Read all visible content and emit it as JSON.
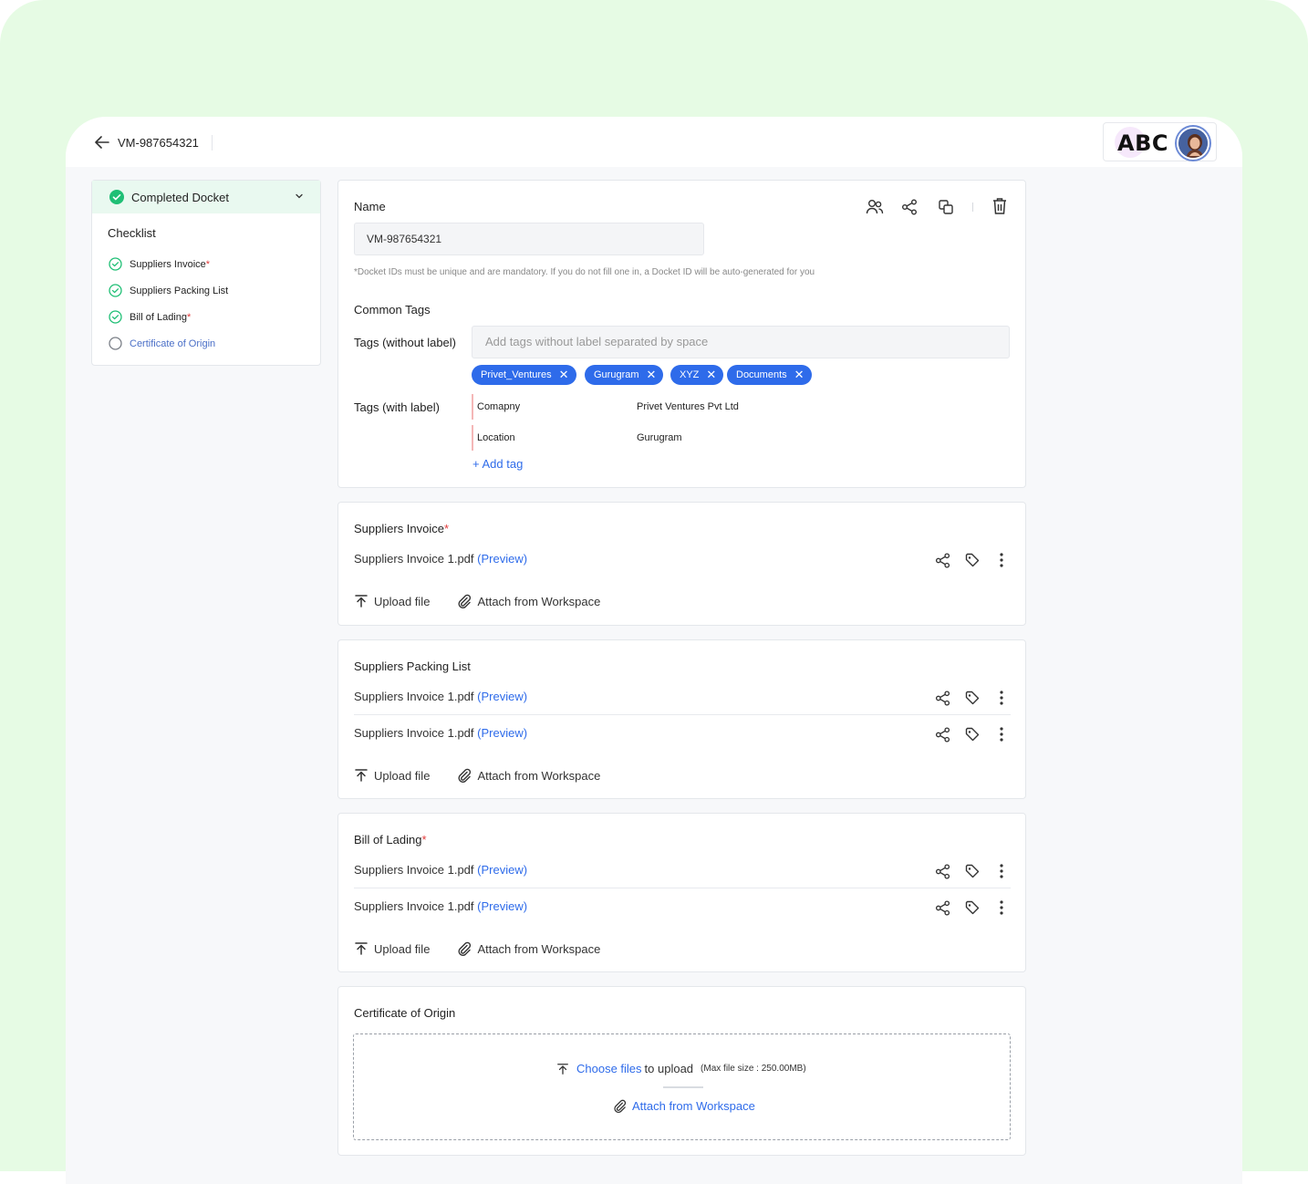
{
  "header": {
    "docket_id": "VM-987654321",
    "brand": "ABC"
  },
  "sidebar": {
    "status_label": "Completed Docket",
    "checklist_title": "Checklist",
    "items": [
      {
        "label": "Suppliers Invoice",
        "required": "*",
        "done": true
      },
      {
        "label": "Suppliers Packing List",
        "required": "",
        "done": true
      },
      {
        "label": "Bill of Lading",
        "required": "*",
        "done": true
      },
      {
        "label": "Certificate of Origin",
        "required": "",
        "done": false
      }
    ]
  },
  "details": {
    "name_label": "Name",
    "name_value": "VM-987654321",
    "hint": "*Docket IDs must be unique and are mandatory. If you do not fill one in, a Docket ID will be auto-generated for you",
    "common_tags_label": "Common Tags",
    "tags_without_label": "Tags (without label)",
    "tags_placeholder": "Add tags without label separated by space",
    "chips": [
      "Privet_Ventures",
      "Gurugram",
      "XYZ",
      "Documents"
    ],
    "tags_with_label": "Tags (with label)",
    "label_tags": [
      {
        "key": "Comapny",
        "value": "Privet Ventures Pvt Ltd"
      },
      {
        "key": "Location",
        "value": "Gurugram"
      }
    ],
    "add_tag": "+ Add tag"
  },
  "sections": {
    "suppliers_invoice": {
      "title": "Suppliers Invoice",
      "required": "*",
      "files": [
        {
          "name": "Suppliers Invoice 1.pdf",
          "preview": "(Preview)"
        }
      ]
    },
    "packing_list": {
      "title": "Suppliers Packing List",
      "files": [
        {
          "name": "Suppliers Invoice 1.pdf",
          "preview": "(Preview)"
        },
        {
          "name": "Suppliers Invoice 1.pdf",
          "preview": "(Preview)"
        }
      ]
    },
    "bill_of_lading": {
      "title": "Bill of Lading",
      "required": "*",
      "files": [
        {
          "name": "Suppliers Invoice 1.pdf",
          "preview": "(Preview)"
        },
        {
          "name": "Suppliers Invoice 1.pdf",
          "preview": "(Preview)"
        }
      ]
    },
    "certificate": {
      "title": "Certificate of Origin",
      "choose_files": "Choose files",
      "to_upload": "to upload",
      "max_size": "(Max file size : 250.00MB)",
      "attach": "Attach from Workspace"
    }
  },
  "actions": {
    "upload": "Upload file",
    "attach": "Attach from Workspace"
  },
  "colors": {
    "accent": "#2e6bea",
    "success": "#1fbf75",
    "page_bg": "#e6fbe4"
  }
}
